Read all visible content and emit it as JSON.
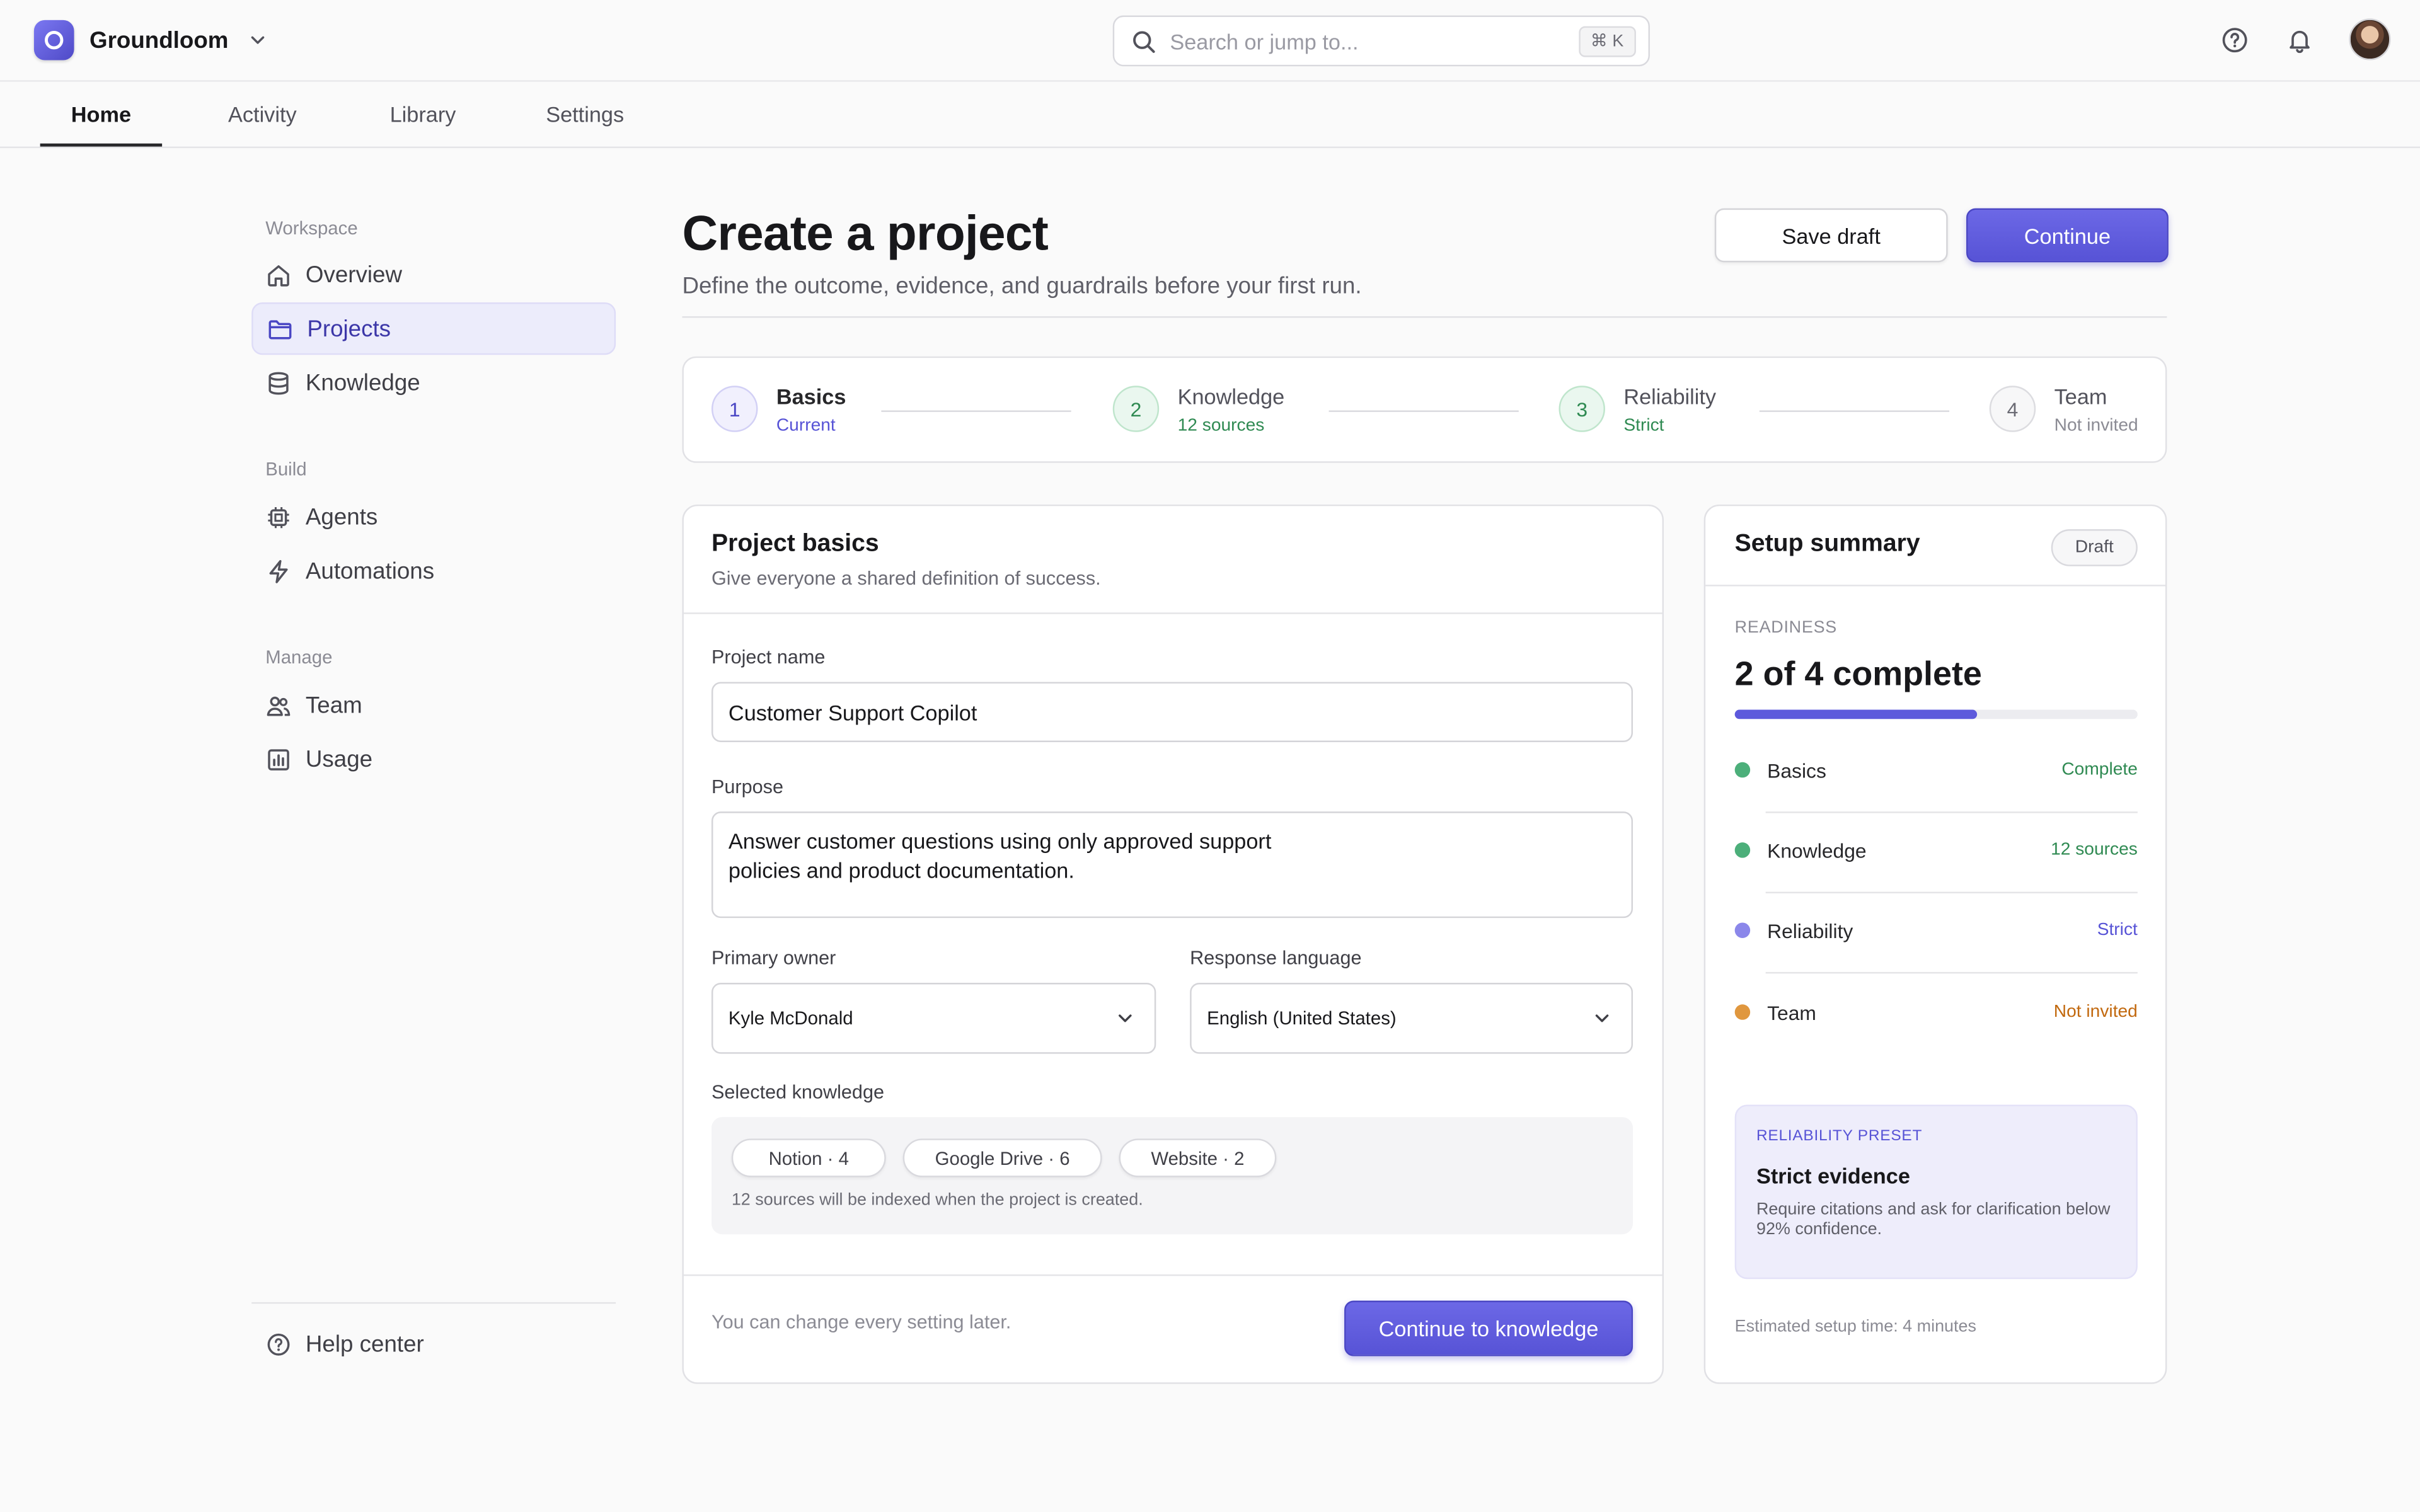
{
  "app": {
    "name": "Groundloom",
    "search_placeholder": "Search or jump to...",
    "search_shortcut": "⌘ K"
  },
  "tabs": [
    {
      "label": "Home",
      "active": true
    },
    {
      "label": "Activity"
    },
    {
      "label": "Library"
    },
    {
      "label": "Settings"
    }
  ],
  "sidebar": {
    "sections": [
      {
        "title": "Workspace",
        "items": [
          {
            "label": "Overview",
            "icon": "home-icon"
          },
          {
            "label": "Projects",
            "icon": "folder-icon",
            "active": true
          },
          {
            "label": "Knowledge",
            "icon": "database-icon"
          }
        ]
      },
      {
        "title": "Build",
        "items": [
          {
            "label": "Agents",
            "icon": "chip-icon"
          },
          {
            "label": "Automations",
            "icon": "bolt-icon"
          }
        ]
      },
      {
        "title": "Manage",
        "items": [
          {
            "label": "Team",
            "icon": "users-icon"
          },
          {
            "label": "Usage",
            "icon": "bar-chart-icon"
          }
        ]
      }
    ],
    "help": "Help center"
  },
  "header": {
    "title": "Create a project",
    "subtitle": "Define the outcome, evidence, and guardrails before your first run.",
    "save_draft": "Save draft",
    "continue": "Continue"
  },
  "steps": [
    {
      "num": "1",
      "title": "Basics",
      "status": "Current",
      "state": "current"
    },
    {
      "num": "2",
      "title": "Knowledge",
      "status": "12 sources",
      "state": "done"
    },
    {
      "num": "3",
      "title": "Reliability",
      "status": "Strict",
      "state": "done"
    },
    {
      "num": "4",
      "title": "Team",
      "status": "Not invited",
      "state": "todo"
    }
  ],
  "basics": {
    "title": "Project basics",
    "subtitle": "Give everyone a shared definition of success.",
    "project_name_label": "Project name",
    "project_name_value": "Customer Support Copilot",
    "purpose_label": "Purpose",
    "purpose_value": "Answer customer questions using only approved support\npolicies and product documentation.",
    "owner_label": "Primary owner",
    "owner_value": "Kyle McDonald",
    "language_label": "Response language",
    "language_value": "English (United States)",
    "knowledge_label": "Selected knowledge",
    "chips": [
      "Notion · 4",
      "Google Drive · 6",
      "Website · 2"
    ],
    "knowledge_note": "12 sources will be indexed when the project is created.",
    "footer_note": "You can change every setting later.",
    "continue_button": "Continue to knowledge"
  },
  "summary": {
    "title": "Setup summary",
    "badge": "Draft",
    "readiness_label": "READINESS",
    "readiness_value": "2 of 4 complete",
    "progress_fraction": 0.6,
    "rows": [
      {
        "name": "Basics",
        "status": "Complete",
        "color": "#4caf7a",
        "status_color": "#2f8a52"
      },
      {
        "name": "Knowledge",
        "status": "12 sources",
        "color": "#4caf7a",
        "status_color": "#2f8a52"
      },
      {
        "name": "Reliability",
        "status": "Strict",
        "color": "#8b87ea",
        "status_color": "#5753d6"
      },
      {
        "name": "Team",
        "status": "Not invited",
        "color": "#e0973e",
        "status_color": "#c2690f"
      }
    ],
    "preset_label": "RELIABILITY PRESET",
    "preset_title": "Strict evidence",
    "preset_desc": "Require citations and ask for clarification below 92% confidence.",
    "estimate": "Estimated setup time: 4 minutes"
  },
  "colors": {
    "accent": "#5753d6",
    "success": "#2f8a52",
    "warning": "#c2690f"
  }
}
